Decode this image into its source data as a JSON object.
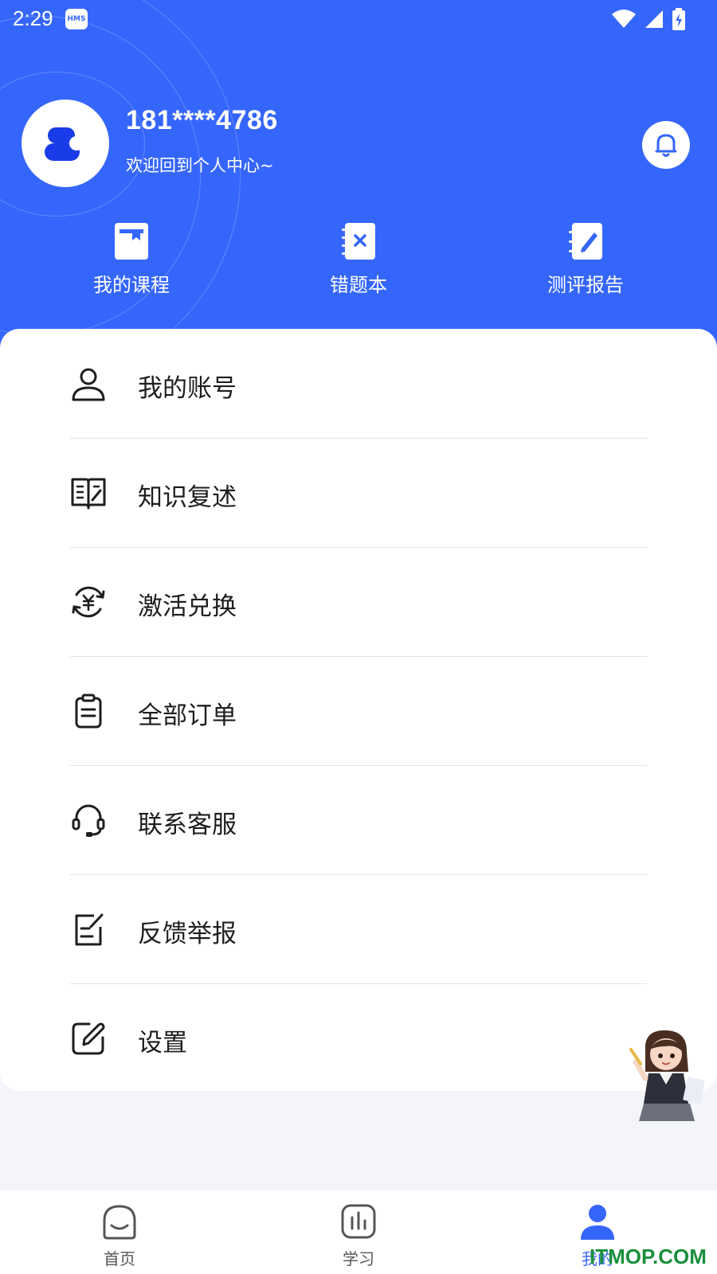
{
  "status_bar": {
    "time": "2:29",
    "badge": "HMS"
  },
  "profile": {
    "phone": "181****4786",
    "welcome": "欢迎回到个人中心~"
  },
  "quick_links": [
    {
      "label": "我的课程",
      "icon": "book-icon"
    },
    {
      "label": "错题本",
      "icon": "mistake-notebook-icon"
    },
    {
      "label": "测评报告",
      "icon": "report-edit-icon"
    }
  ],
  "menu": [
    {
      "label": "我的账号",
      "icon": "user-icon"
    },
    {
      "label": "知识复述",
      "icon": "open-book-icon"
    },
    {
      "label": "激活兑换",
      "icon": "yuan-exchange-icon"
    },
    {
      "label": "全部订单",
      "icon": "clipboard-icon"
    },
    {
      "label": "联系客服",
      "icon": "headset-icon"
    },
    {
      "label": "反馈举报",
      "icon": "feedback-icon"
    },
    {
      "label": "设置",
      "icon": "edit-square-icon"
    }
  ],
  "tabs": [
    {
      "label": "首页",
      "icon": "home-icon"
    },
    {
      "label": "学习",
      "icon": "chart-icon"
    },
    {
      "label": "我的",
      "icon": "person-icon",
      "active": true
    }
  ],
  "watermark": "ITMOP.COM",
  "colors": {
    "primary": "#3566fc",
    "text": "#1e1e1e",
    "background": "#f4f5f8"
  }
}
